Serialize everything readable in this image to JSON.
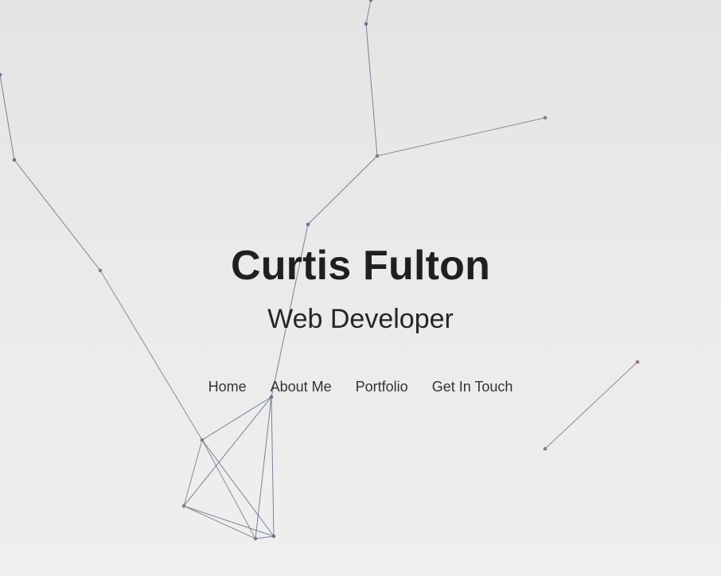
{
  "hero": {
    "name": "Curtis Fulton",
    "role": "Web Developer"
  },
  "nav": {
    "items": [
      {
        "label": "Home"
      },
      {
        "label": "About Me"
      },
      {
        "label": "Portfolio"
      },
      {
        "label": "Get In Touch"
      }
    ]
  },
  "background": {
    "colors": {
      "bg_top": "#e4e4e4",
      "bg_bottom": "#efefef",
      "line_blue": "#6b7590",
      "line_mauve": "#8e7a80"
    }
  }
}
